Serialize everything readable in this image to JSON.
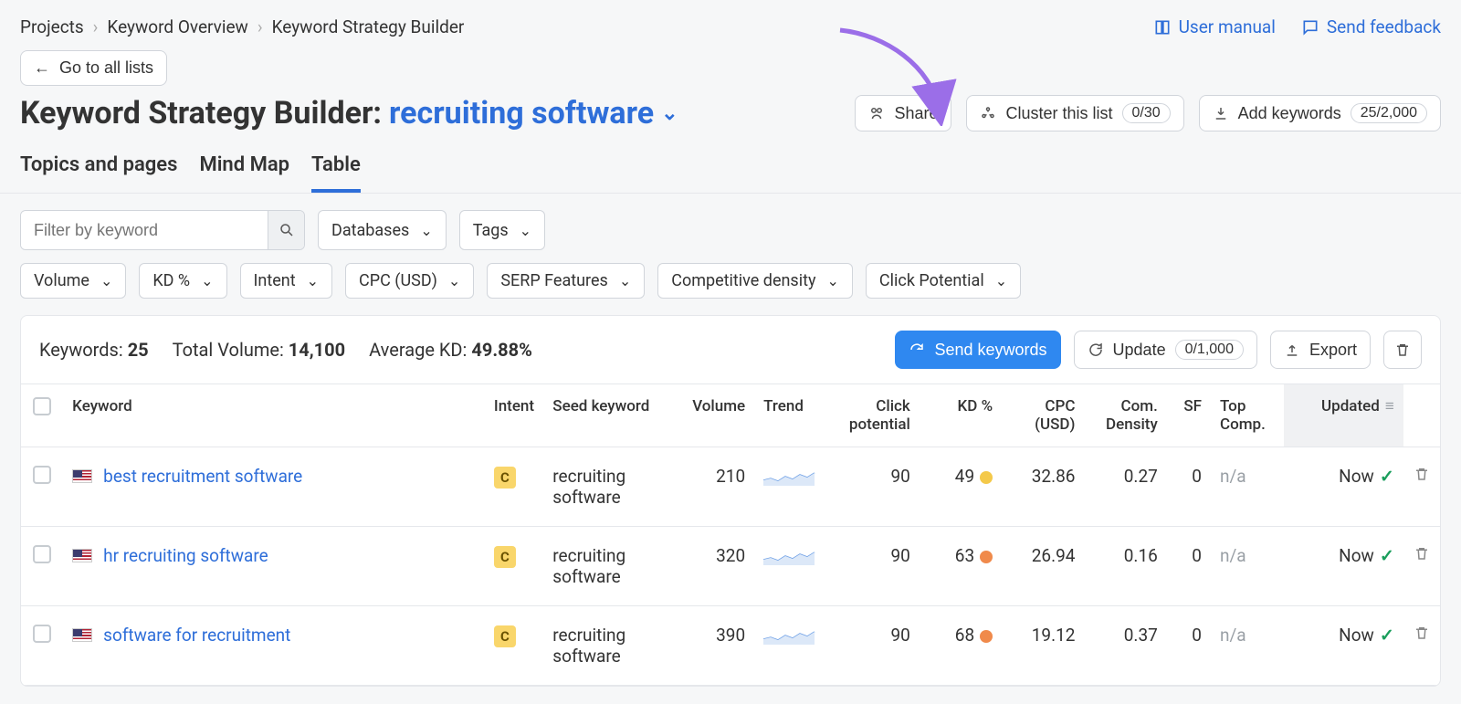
{
  "breadcrumbs": [
    "Projects",
    "Keyword Overview",
    "Keyword Strategy Builder"
  ],
  "topLinks": {
    "manual": "User manual",
    "feedback": "Send feedback"
  },
  "buttons": {
    "goLists": "Go to all lists",
    "share": "Share",
    "cluster": "Cluster this list",
    "clusterBadge": "0/30",
    "addKeywords": "Add keywords",
    "addKeywordsBadge": "25/2,000",
    "send": "Send keywords",
    "update": "Update",
    "updateBadge": "0/1,000",
    "export": "Export"
  },
  "title": {
    "prefix": "Keyword Strategy Builder:",
    "listName": "recruiting software"
  },
  "tabs": [
    "Topics and pages",
    "Mind Map",
    "Table"
  ],
  "activeTab": "Table",
  "filters": {
    "searchPlaceholder": "Filter by keyword",
    "row1": [
      "Databases",
      "Tags"
    ],
    "row2": [
      "Volume",
      "KD %",
      "Intent",
      "CPC (USD)",
      "SERP Features",
      "Competitive density",
      "Click Potential"
    ]
  },
  "summary": {
    "keywordsLabel": "Keywords:",
    "keywordsValue": "25",
    "volumeLabel": "Total Volume:",
    "volumeValue": "14,100",
    "avgKdLabel": "Average KD:",
    "avgKdValue": "49.88%"
  },
  "tableHead": {
    "keyword": "Keyword",
    "intent": "Intent",
    "seed": "Seed keyword",
    "volume": "Volume",
    "trend": "Trend",
    "click": "Click potential",
    "kd": "KD %",
    "cpc": "CPC (USD)",
    "com": "Com. Density",
    "sf": "SF",
    "topComp": "Top Comp.",
    "updated": "Updated"
  },
  "rows": [
    {
      "keyword": "best recruitment software",
      "intent": "C",
      "seed": "recruiting software",
      "volume": "210",
      "click": "90",
      "kd": "49",
      "kdColor": "yellow",
      "cpc": "32.86",
      "com": "0.27",
      "sf": "0",
      "topComp": "n/a",
      "updated": "Now"
    },
    {
      "keyword": "hr recruiting software",
      "intent": "C",
      "seed": "recruiting software",
      "volume": "320",
      "click": "90",
      "kd": "63",
      "kdColor": "orange",
      "cpc": "26.94",
      "com": "0.16",
      "sf": "0",
      "topComp": "n/a",
      "updated": "Now"
    },
    {
      "keyword": "software for recruitment",
      "intent": "C",
      "seed": "recruiting software",
      "volume": "390",
      "click": "90",
      "kd": "68",
      "kdColor": "orange",
      "cpc": "19.12",
      "com": "0.37",
      "sf": "0",
      "topComp": "n/a",
      "updated": "Now"
    }
  ]
}
